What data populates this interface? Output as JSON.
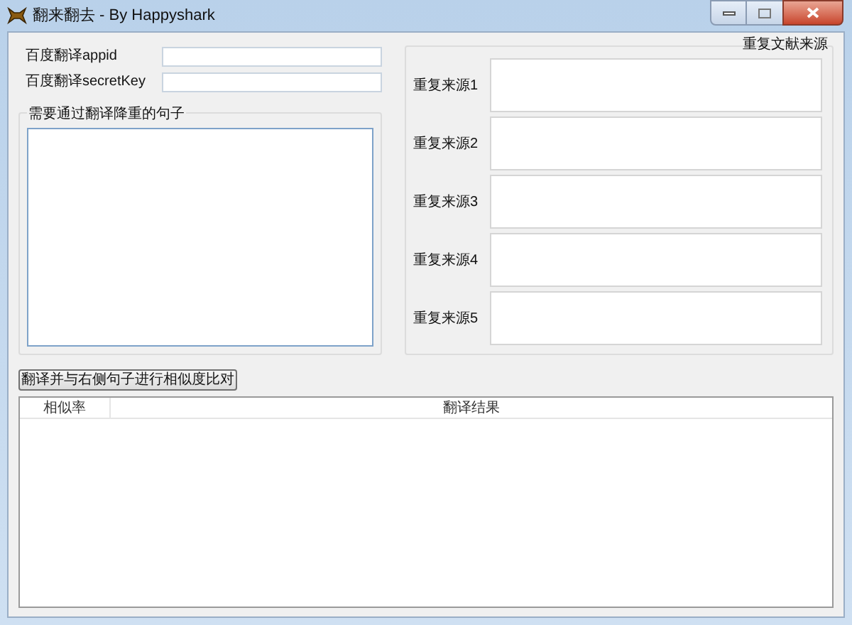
{
  "window": {
    "title": "翻来翻去 - By Happyshark"
  },
  "credentials": [
    {
      "label": "百度翻译appid"
    },
    {
      "label": "百度翻译secretKey"
    }
  ],
  "source": {
    "label": "需要通过翻译降重的句子"
  },
  "sources_group": {
    "title": "重复文献来源",
    "items": [
      {
        "label": "重复来源1"
      },
      {
        "label": "重复来源2"
      },
      {
        "label": "重复来源3"
      },
      {
        "label": "重复来源4"
      },
      {
        "label": "重复来源5"
      }
    ]
  },
  "compare_button": "翻译并与右侧句子进行相似度比对",
  "table": {
    "columns": [
      "相似率",
      "翻译结果"
    ]
  }
}
